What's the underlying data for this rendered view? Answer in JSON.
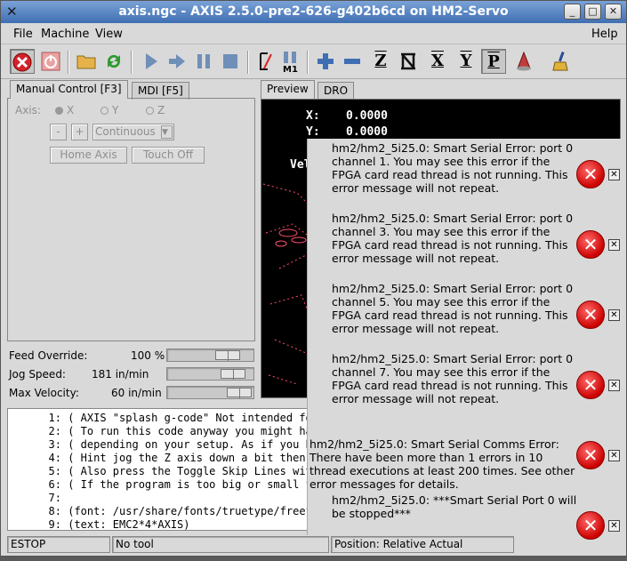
{
  "window": {
    "title": "axis.ngc - AXIS 2.5.0-pre2-626-g402b6cd on HM2-Servo",
    "wm_icon": "x-logo-icon",
    "buttons": {
      "minimize": "_",
      "maximize": "□",
      "close": "✕"
    }
  },
  "menu": {
    "file": "File",
    "machine": "Machine",
    "view": "View",
    "help": "Help"
  },
  "toolbar": {
    "icons": [
      "estop-icon",
      "machine-power-icon",
      "open-file-icon",
      "reload-icon",
      "run-icon",
      "step-icon",
      "pause-icon",
      "stop-icon",
      "skip-lines-icon",
      "optional-stop-icon",
      "zoom-in-icon",
      "zoom-out-icon",
      "view-z-icon",
      "view-z2-icon",
      "view-x-icon",
      "view-y-icon",
      "view-p-icon",
      "rotate-view-icon",
      "clear-plot-icon"
    ],
    "labels": {
      "view_z": "Z",
      "view_x": "X",
      "view_y": "Y",
      "view_p": "P",
      "m1": "M1"
    }
  },
  "left_tabs": {
    "manual": "Manual Control [F3]",
    "mdi": "MDI [F5]"
  },
  "manual": {
    "axis_label": "Axis:",
    "axes": [
      "X",
      "Y",
      "Z"
    ],
    "minus": "-",
    "plus": "+",
    "jog_mode": "Continuous",
    "home_axis": "Home Axis",
    "touch_off": "Touch Off"
  },
  "overrides": {
    "feed_label": "Feed Override:",
    "feed_value": "100 %",
    "jog_label": "Jog Speed:",
    "jog_value": "181 in/min",
    "maxvel_label": "Max Velocity:",
    "maxvel_value": "60 in/min"
  },
  "preview_tabs": {
    "preview": "Preview",
    "dro": "DRO"
  },
  "dro": {
    "x_label": "X:",
    "x_value": "0.0000",
    "y_label": "Y:",
    "y_value": "0.0000",
    "vel_label": "Vel"
  },
  "gcode": [
    {
      "n": "1:",
      "text": "( AXIS \"splash g-code\" Not intended for"
    },
    {
      "n": "2:",
      "text": "( To run this code anyway you might have"
    },
    {
      "n": "3:",
      "text": "( depending on your setup. As if you had"
    },
    {
      "n": "4:",
      "text": "( Hint jog the Z axis down a bit then to"
    },
    {
      "n": "5:",
      "text": "( Also press the Toggle Skip Lines with"
    },
    {
      "n": "6:",
      "text": "( If the program is too big or small for"
    },
    {
      "n": "7:",
      "text": ""
    },
    {
      "n": "8:",
      "text": "(font: /usr/share/fonts/truetype/freefor"
    },
    {
      "n": "9:",
      "text": "(text: EMC2*4*AXIS)"
    }
  ],
  "notifications": [
    {
      "text": "hm2/hm2_5i25.0: Smart Serial Error: port 0 channel 1. You may see this error if the FPGA card read thread is not running. This error message will not repeat."
    },
    {
      "text": "hm2/hm2_5i25.0: Smart Serial Error: port 0 channel 3. You may see this error if the FPGA card read thread is not running. This error message will not repeat."
    },
    {
      "text": "hm2/hm2_5i25.0: Smart Serial Error: port 0 channel 5. You may see this error if the FPGA card read thread is not running. This error message will not repeat."
    },
    {
      "text": "hm2/hm2_5i25.0: Smart Serial Error: port 0 channel 7. You may see this error if the FPGA card read thread is not running. This error message will not repeat."
    },
    {
      "text": "hm2/hm2_5i25.0: Smart Serial Comms Error: There have been more than 1 errors in 10 thread executions at least 200 times. See other error messages for details."
    },
    {
      "text": "hm2/hm2_5i25.0: ***Smart Serial Port 0 will be stopped***"
    }
  ],
  "notif_icon": "error-x-icon",
  "notif_close": "✕",
  "status": {
    "estop": "ESTOP",
    "tool": "No tool",
    "position": "Position: Relative Actual"
  },
  "colors": {
    "titlebar": "#4f7fc0",
    "preview_bg": "#000000",
    "plot_lines": "#ff4d6d"
  },
  "sliders": {
    "feed_override_pct": 0.8,
    "jog_speed_pct": 0.9,
    "max_velocity_pct": 1.0
  }
}
